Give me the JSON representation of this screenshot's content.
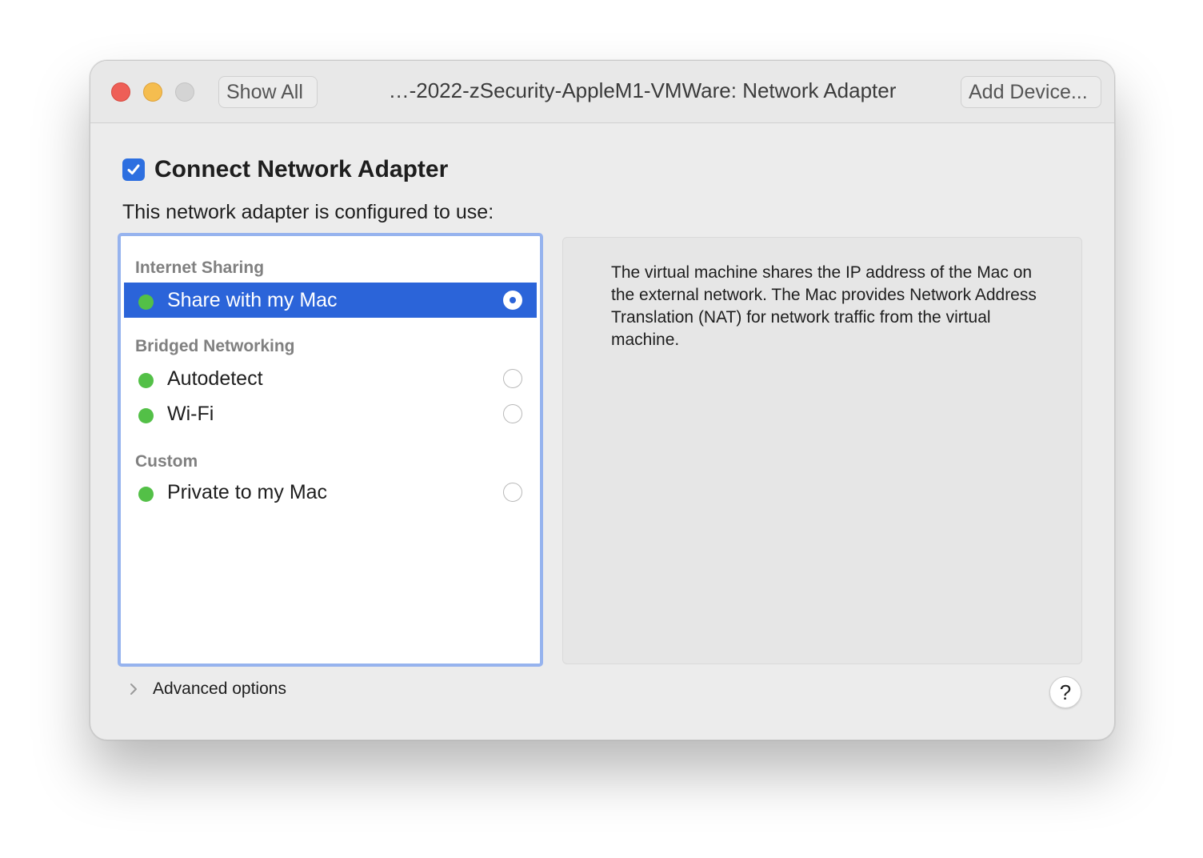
{
  "window": {
    "title": "…-2022-zSecurity-AppleM1-VMWare: Network Adapter"
  },
  "toolbar": {
    "show_all_label": "Show All",
    "add_device_label": "Add Device..."
  },
  "connect": {
    "label": "Connect Network Adapter",
    "checked": true
  },
  "configured_label": "This network adapter is configured to use:",
  "network_list": {
    "groups": [
      {
        "header": "Internet Sharing",
        "items": [
          {
            "label": "Share with my Mac",
            "status": "connected",
            "selected": true
          }
        ]
      },
      {
        "header": "Bridged Networking",
        "items": [
          {
            "label": "Autodetect",
            "status": "connected",
            "selected": false
          },
          {
            "label": "Wi-Fi",
            "status": "connected",
            "selected": false
          }
        ]
      },
      {
        "header": "Custom",
        "items": [
          {
            "label": "Private to my Mac",
            "status": "connected",
            "selected": false
          }
        ]
      }
    ]
  },
  "description": "The virtual machine shares the IP address of the Mac on the external network. The Mac provides Network Address Translation (NAT) for network traffic from the virtual machine.",
  "advanced": {
    "label": "Advanced options",
    "expanded": false
  },
  "help": {
    "label": "?"
  },
  "colors": {
    "accent": "#2b64d9",
    "status_green": "#53c047",
    "close": "#ee5f57",
    "minimize": "#f5bd4f",
    "zoom_inactive": "#d4d4d4"
  }
}
